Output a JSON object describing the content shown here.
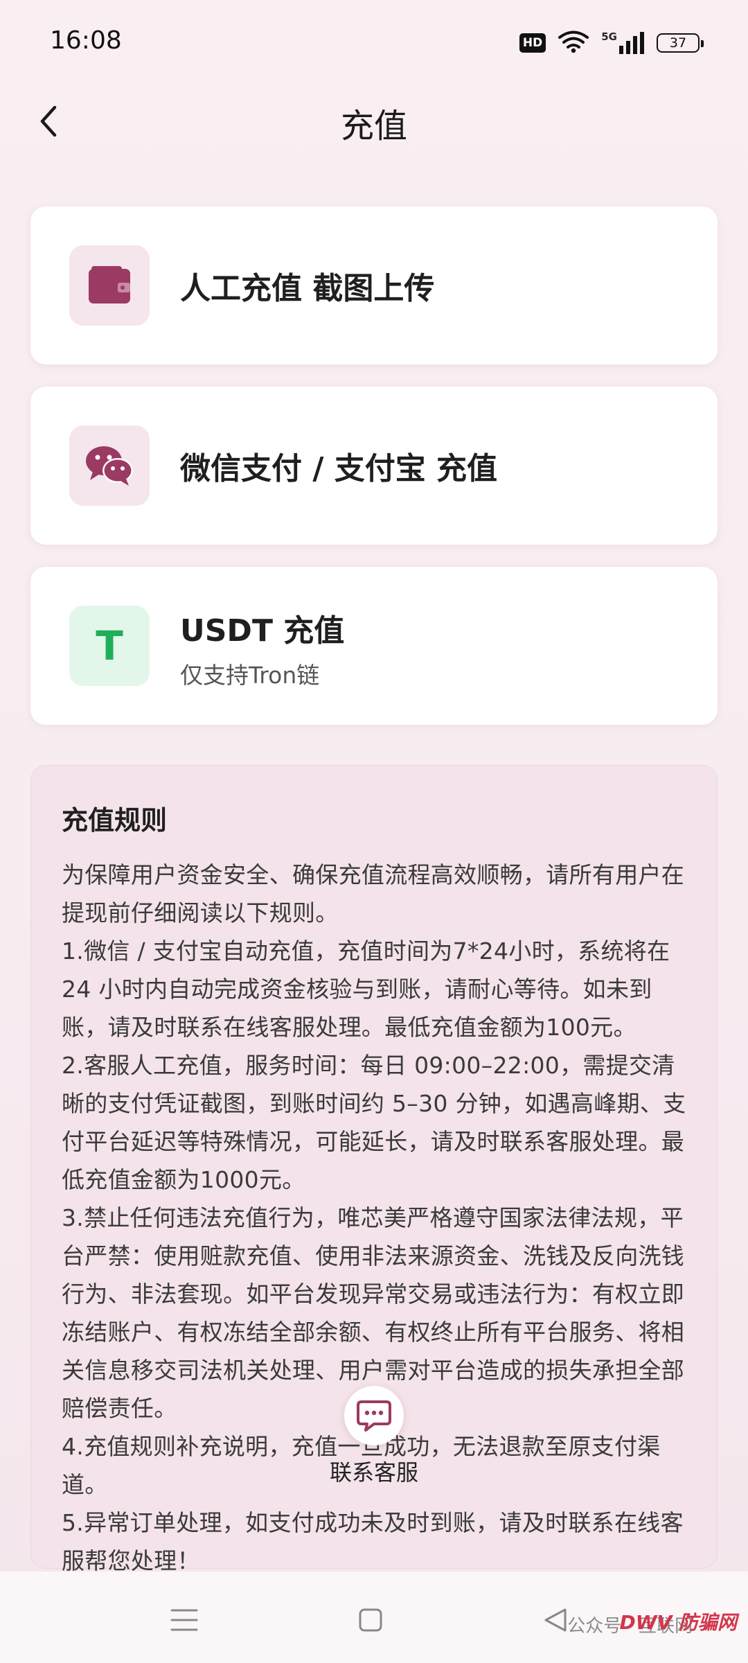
{
  "status_bar": {
    "time": "16:08",
    "hd": "HD",
    "network": "5G",
    "battery": "37"
  },
  "nav": {
    "title": "充值"
  },
  "options": [
    {
      "title": "人工充值 截图上传",
      "icon": "wallet-icon",
      "icon_color": "#9b3a63"
    },
    {
      "title": "微信支付 / 支付宝 充值",
      "icon": "wechat-icon",
      "icon_color": "#9b3a63"
    },
    {
      "title": "USDT 充值",
      "subtitle": "仅支持Tron链",
      "icon": "tether-icon",
      "icon_letter": "T",
      "icon_color": "#1fae5a"
    }
  ],
  "rules": {
    "title": "充值规则",
    "paragraphs": [
      "为保障用户资金安全、确保充值流程高效顺畅，请所有用户在提现前仔细阅读以下规则。",
      "1.微信 / 支付宝自动充值，充值时间为7*24小时，系统将在24 小时内自动完成资金核验与到账，请耐心等待。如未到账，请及时联系在线客服处理。最低充值金额为100元。",
      "2.客服人工充值，服务时间：每日 09:00–22:00，需提交清晰的支付凭证截图，到账时间约 5–30 分钟，如遇高峰期、支付平台延迟等特殊情况，可能延长，请及时联系客服处理。最低充值金额为1000元。",
      "3.禁止任何违法充值行为，唯芯美严格遵守国家法律法规，平台严禁：使用赃款充值、使用非法来源资金、洗钱及反向洗钱行为、非法套现。如平台发现异常交易或违法行为：有权立即冻结账户、有权冻结全部余额、有权终止所有平台服务、将相关信息移交司法机关处理、用户需对平台造成的损失承担全部赔偿责任。",
      "4.充值规则补充说明，充值一旦成功，无法退款至原支付渠道。",
      "5.异常订单处理，如支付成功未及时到账，请及时联系在线客服帮您处理！"
    ]
  },
  "customer_service": {
    "label": "联系客服"
  },
  "watermark": {
    "text": "公众号 · 互联网",
    "logo": "DWV 防骗网"
  },
  "colors": {
    "accent": "#9b3a63",
    "usdt": "#1fae5a",
    "background": "#f9eef2"
  }
}
